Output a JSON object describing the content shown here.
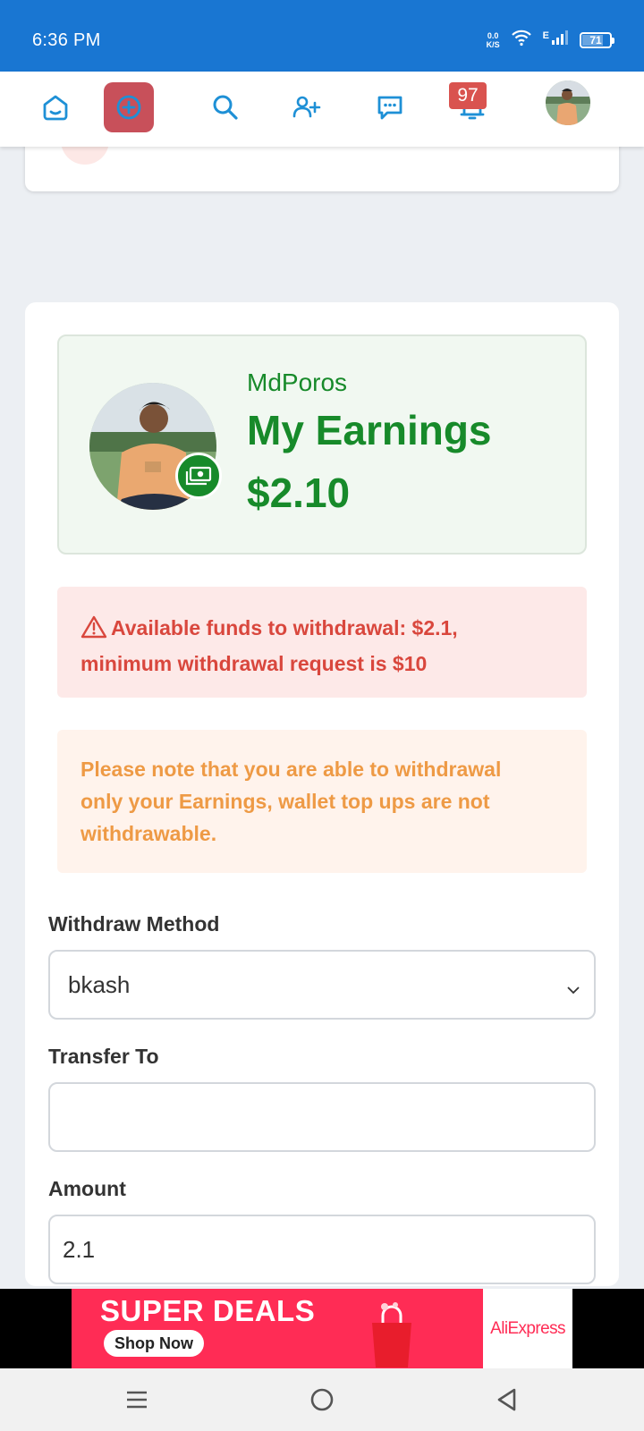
{
  "status_bar": {
    "time": "6:36 PM",
    "net_speed_value": "0.0",
    "net_speed_unit": "K/S",
    "signal_type": "E",
    "battery_level": "71",
    "battery_fraction": 0.71
  },
  "top_nav": {
    "icons": [
      "home-icon",
      "create-post-icon",
      "search-icon",
      "add-friend-icon",
      "messages-icon",
      "notifications-icon"
    ],
    "notification_count": "97"
  },
  "earnings": {
    "username": "MdPoros",
    "title": "My Earnings",
    "amount": "$2.10"
  },
  "alerts": {
    "available_funds_line1": "Available funds to withdrawal: $2.1,",
    "available_funds_line2": "minimum withdrawal request is $10",
    "note_line1": "Please note that you are able to withdrawal",
    "note_line2": "only your Earnings, wallet top ups are not",
    "note_line3": "withdrawable."
  },
  "form": {
    "method_label": "Withdraw Method",
    "method_value": "bkash",
    "transfer_label": "Transfer To",
    "transfer_value": "",
    "amount_label": "Amount",
    "amount_value": "2.1"
  },
  "ad": {
    "headline": "SUPER DEALS",
    "cta": "Shop Now",
    "brand": "AliExpress",
    "background_color": "#ff2c55"
  },
  "colors": {
    "status_bar": "#1976d2",
    "accent_green": "#178a2a",
    "alert_red": "#d9473d",
    "alert_orange": "#ee9a45",
    "nav_icon_blue": "#1e90d6"
  }
}
